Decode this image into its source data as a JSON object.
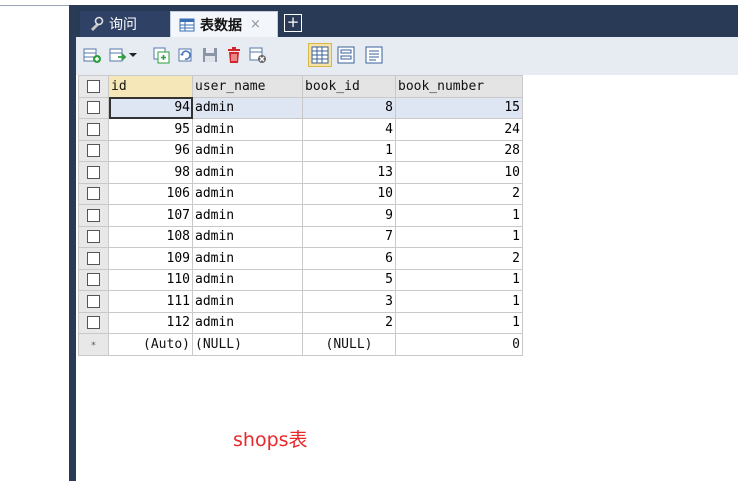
{
  "tabs": [
    {
      "label": "询问",
      "icon": "query-icon"
    },
    {
      "label": "表数据",
      "icon": "table-icon",
      "close": "×"
    }
  ],
  "tab_add": "+",
  "toolbar_icons": [
    "insert-row-icon",
    "export-icon",
    "duplicate-icon",
    "refresh-icon",
    "save-icon",
    "delete-icon",
    "filter-icon",
    "grid-view-icon",
    "form-view-icon",
    "text-view-icon"
  ],
  "grid": {
    "columns": [
      "id",
      "user_name",
      "book_id",
      "book_number"
    ],
    "rows": [
      [
        "94",
        "admin",
        "8",
        "15"
      ],
      [
        "95",
        "admin",
        "4",
        "24"
      ],
      [
        "96",
        "admin",
        "1",
        "28"
      ],
      [
        "98",
        "admin",
        "13",
        "10"
      ],
      [
        "106",
        "admin",
        "10",
        "2"
      ],
      [
        "107",
        "admin",
        "9",
        "1"
      ],
      [
        "108",
        "admin",
        "7",
        "1"
      ],
      [
        "109",
        "admin",
        "6",
        "2"
      ],
      [
        "110",
        "admin",
        "5",
        "1"
      ],
      [
        "111",
        "admin",
        "3",
        "1"
      ],
      [
        "112",
        "admin",
        "2",
        "1"
      ]
    ],
    "new_row_marker": "*",
    "new_row": [
      "(Auto)",
      "(NULL)",
      "(NULL)",
      "0"
    ]
  },
  "caption": "shops表",
  "colors": {
    "frame": "#293a57",
    "caption": "#e8282a",
    "sorted_header": "#f6e7b8"
  }
}
